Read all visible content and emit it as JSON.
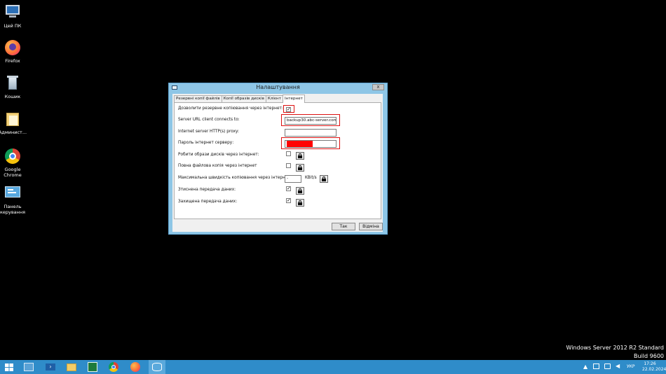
{
  "desktop": {
    "icons": [
      {
        "label": "Цей ПК",
        "icon": "computer-icon"
      },
      {
        "label": "Firefox",
        "icon": "firefox-icon"
      },
      {
        "label": "Кошик",
        "icon": "recycle-bin-icon"
      },
      {
        "label": "Админист...",
        "icon": "folder-icon"
      },
      {
        "label": "Google Chrome",
        "icon": "chrome-icon"
      },
      {
        "label": "Панель керування",
        "icon": "control-panel-icon"
      }
    ],
    "watermark_line1": "Windows Server 2012 R2 Standard",
    "watermark_line2": "Build 9600"
  },
  "dialog": {
    "title": "Налаштування",
    "close_label": "x",
    "tabs": [
      {
        "label": "Резервні копії файлів"
      },
      {
        "label": "Копії образів дисків"
      },
      {
        "label": "Клієнт"
      },
      {
        "label": "Інтернет",
        "active": true
      }
    ],
    "fields": {
      "allow_backup_label": "Дозволити резервне копіювання через інтернет:",
      "allow_backup_checked": true,
      "server_url_label": "Server URL client connects to:",
      "server_url_value": "backup30.abc-server.com",
      "proxy_label": "Internet server HTTP(s) proxy:",
      "proxy_value": "",
      "password_label": "Пароль інтернет серверу:",
      "image_backup_label": "Робити образи дисків через інтернет:",
      "image_backup_checked": false,
      "full_file_backup_label": "Повна файлова копія через інтернет",
      "full_file_backup_checked": false,
      "max_speed_label": "Максимальна швидкість копіювання через інтернет:",
      "max_speed_value": "-",
      "max_speed_unit": "KBit/s",
      "compressed_label": "Зтиснена передача даних:",
      "compressed_checked": true,
      "encrypted_label": "Захищена передача даних:",
      "encrypted_checked": true
    },
    "ok_label": "Так",
    "cancel_label": "Відміна",
    "highlight_color": "#dd1111"
  },
  "taskbar": {
    "items": [
      "start-icon",
      "server-manager-icon",
      "powershell-icon",
      "file-explorer-icon",
      "excel-icon",
      "chrome-icon",
      "firefox-icon",
      "database-app-icon"
    ],
    "language": "УКР",
    "time": "17:26",
    "date": "22.02.2024"
  }
}
